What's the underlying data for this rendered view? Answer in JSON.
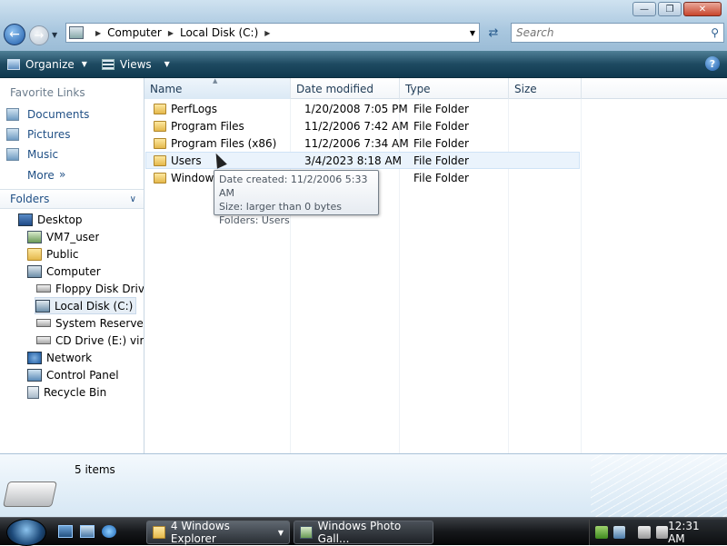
{
  "address": {
    "crumbs": [
      "Computer",
      "Local Disk (C:)"
    ]
  },
  "search": {
    "placeholder": "Search"
  },
  "toolbar": {
    "organize_label": "Organize",
    "views_label": "Views"
  },
  "navpane": {
    "favorites_title": "Favorite Links",
    "favorites": [
      {
        "label": "Documents",
        "icon": "documents-icon"
      },
      {
        "label": "Pictures",
        "icon": "pictures-icon"
      },
      {
        "label": "Music",
        "icon": "music-icon"
      }
    ],
    "more_label": "More",
    "more_arrow": "»",
    "folders_label": "Folders",
    "tree": [
      {
        "label": "Desktop",
        "icon": "desktop-icon"
      },
      {
        "label": "VM7_user",
        "icon": "user-folder-icon"
      },
      {
        "label": "Public",
        "icon": "folder-icon"
      },
      {
        "label": "Computer",
        "icon": "computer-icon"
      },
      {
        "label": "Floppy Disk Drive",
        "icon": "floppy-drive-icon"
      },
      {
        "label": "Local Disk (C:)",
        "icon": "local-disk-icon",
        "selected": true
      },
      {
        "label": "System Reserved (",
        "icon": "drive-icon"
      },
      {
        "label": "CD Drive (E:) virtic",
        "icon": "cd-drive-icon"
      },
      {
        "label": "Network",
        "icon": "network-icon"
      },
      {
        "label": "Control Panel",
        "icon": "control-panel-icon"
      },
      {
        "label": "Recycle Bin",
        "icon": "recycle-bin-icon"
      }
    ]
  },
  "columns": [
    "Name",
    "Date modified",
    "Type",
    "Size"
  ],
  "files": [
    {
      "name": "PerfLogs",
      "date": "1/20/2008 7:05 PM",
      "type": "File Folder"
    },
    {
      "name": "Program Files",
      "date": "11/2/2006 7:42 AM",
      "type": "File Folder"
    },
    {
      "name": "Program Files (x86)",
      "date": "11/2/2006 7:34 AM",
      "type": "File Folder"
    },
    {
      "name": "Users",
      "date": "3/4/2023 8:18 AM",
      "type": "File Folder"
    },
    {
      "name": "Windows",
      "date": "",
      "type": "File Folder"
    }
  ],
  "tooltip": {
    "line1": "Date created: 11/2/2006 5:33 AM",
    "line2": "Size: larger than 0 bytes",
    "line3": "Folders: Users"
  },
  "details": {
    "count": "5 items"
  },
  "taskbar": {
    "explorer_label": "4 Windows Explorer",
    "photo_label": "Windows Photo Gall...",
    "clock": "12:31 AM"
  }
}
